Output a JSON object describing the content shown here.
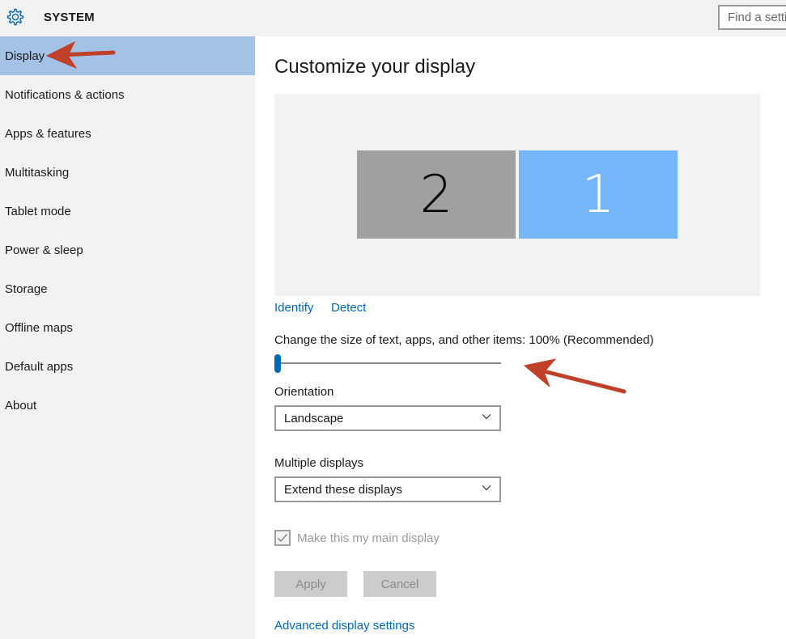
{
  "header": {
    "icon": "gear-icon",
    "title": "SYSTEM",
    "search_placeholder": "Find a setting"
  },
  "sidebar": {
    "items": [
      {
        "label": "Display",
        "active": true
      },
      {
        "label": "Notifications & actions"
      },
      {
        "label": "Apps & features"
      },
      {
        "label": "Multitasking"
      },
      {
        "label": "Tablet mode"
      },
      {
        "label": "Power & sleep"
      },
      {
        "label": "Storage"
      },
      {
        "label": "Offline maps"
      },
      {
        "label": "Default apps"
      },
      {
        "label": "About"
      }
    ]
  },
  "main": {
    "title": "Customize your display",
    "monitors": [
      {
        "number": "2",
        "selected": false
      },
      {
        "number": "1",
        "selected": true
      }
    ],
    "identify_link": "Identify",
    "detect_link": "Detect",
    "scale_label": "Change the size of text, apps, and other items: 100% (Recommended)",
    "scale_slider_fraction": 0.0,
    "orientation_label": "Orientation",
    "orientation_value": "Landscape",
    "multiple_displays_label": "Multiple displays",
    "multiple_displays_value": "Extend these displays",
    "main_display_label": "Make this my main display",
    "main_display_checked": true,
    "apply_button": "Apply",
    "cancel_button": "Cancel",
    "advanced_link": "Advanced display settings"
  },
  "annotations": {
    "arrow_color": "#c0412a"
  },
  "colors": {
    "accent": "#0067b8",
    "sidebar_active": "#a4c2e6",
    "monitor_selected": "#74b6f8",
    "monitor_other": "#a0a0a0"
  }
}
